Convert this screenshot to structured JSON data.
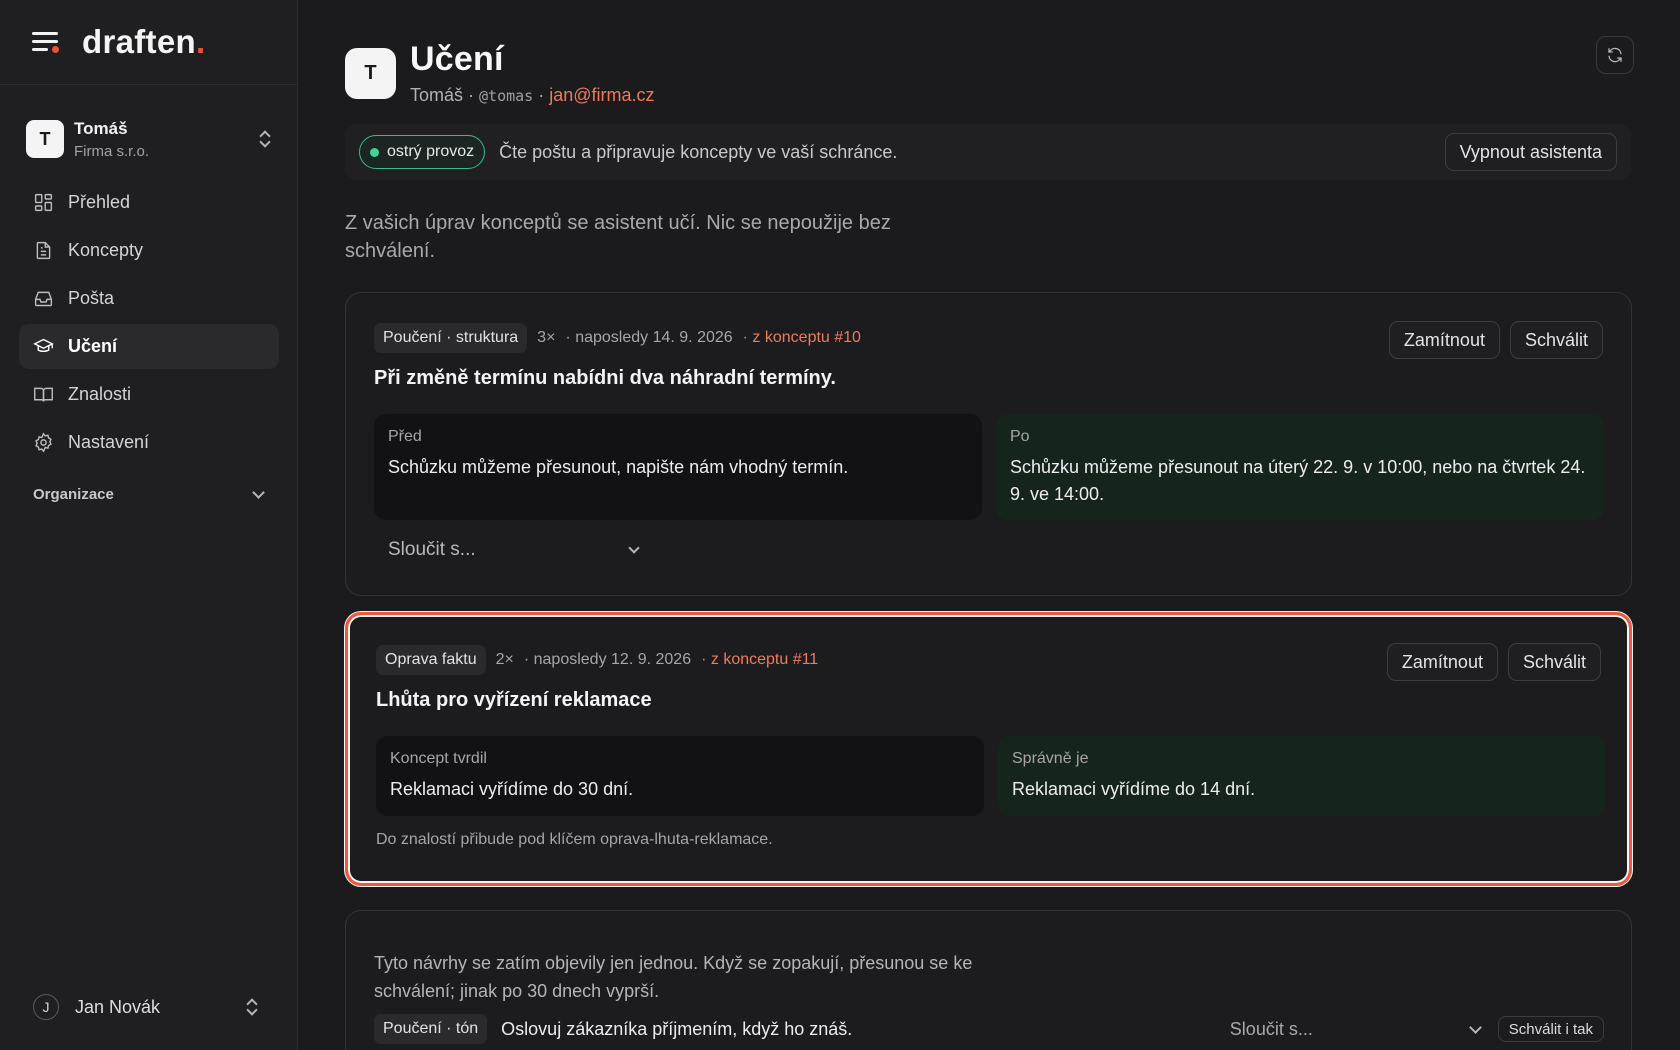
{
  "brand": {
    "name": "draften",
    "dot": "."
  },
  "account": {
    "initial": "T",
    "name": "Tomáš",
    "org": "Firma s.r.o."
  },
  "nav": [
    {
      "label": "Přehled",
      "icon": "grid-icon"
    },
    {
      "label": "Koncepty",
      "icon": "document-icon"
    },
    {
      "label": "Pošta",
      "icon": "inbox-icon"
    },
    {
      "label": "Učení",
      "icon": "graduation-cap-icon",
      "active": true
    },
    {
      "label": "Znalosti",
      "icon": "book-icon"
    },
    {
      "label": "Nastavení",
      "icon": "gear-icon"
    }
  ],
  "org_group": {
    "label": "Organizace"
  },
  "user": {
    "initial": "J",
    "name": "Jan Novák"
  },
  "page": {
    "initial": "T",
    "title": "Učení",
    "sub_name": "Tomáš · ",
    "sub_handle": "@tomas",
    "sub_sep": " · ",
    "sub_email": "jan@firma.cz"
  },
  "status": {
    "badge": "ostrý provoz",
    "text": "Čte poštu a připravuje koncepty ve vaší schránce.",
    "button": "Vypnout asistenta"
  },
  "intro": "Z vašich úprav konceptů se asistent učí. Nic se nepoužije bez schválení.",
  "cards": [
    {
      "tag": "Poučení · struktura",
      "count": "3×",
      "date": "· naposledy 14. 9. 2026",
      "link": "· z konceptu #10",
      "reject": "Zamítnout",
      "approve": "Schválit",
      "title": "Při změně termínu nabídni dva náhradní termíny.",
      "left_label": "Před",
      "left_text": "Schůzku můžeme přesunout, napište nám vhodný termín.",
      "right_label": "Po",
      "right_text": "Schůzku můžeme přesunout na úterý 22. 9. v 10:00, nebo na čtvrtek 24. 9. ve 14:00.",
      "merge": "Sloučit s..."
    },
    {
      "tag": "Oprava faktu",
      "count": "2×",
      "date": "· naposledy 12. 9. 2026",
      "link": "· z konceptu #11",
      "reject": "Zamítnout",
      "approve": "Schválit",
      "title": "Lhůta pro vyřízení reklamace",
      "left_label": "Koncept tvrdil",
      "left_text": "Reklamaci vyřídíme do 30 dní.",
      "right_label": "Správně je",
      "right_text": "Reklamaci vyřídíme do 14 dní.",
      "note": "Do znalostí přibude pod klíčem oprava-lhuta-reklamace."
    }
  ],
  "pending": {
    "text": "Tyto návrhy se zatím objevily jen jednou. Když se zopakují, přesunou se ke schválení; jinak po 30 dnech vyprší.",
    "tag": "Poučení · tón",
    "rule": "Oslovuj zákazníka příjmením, když ho znáš.",
    "merge": "Sloučit s...",
    "approve": "Schválit i tak"
  },
  "colors": {
    "accent": "#ef5a3c",
    "link": "#ef7a5c",
    "live": "#3fd49a",
    "after_bg": "#16251c"
  }
}
